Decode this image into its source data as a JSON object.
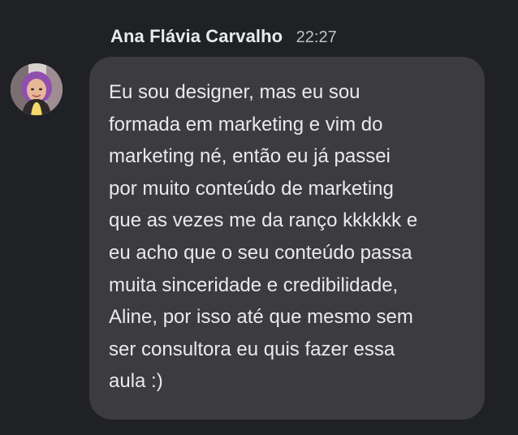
{
  "message": {
    "sender": "Ana Flávia Carvalho",
    "time": "22:27",
    "lines": [
      "Eu sou designer, mas eu sou",
      "formada em marketing e vim do",
      "marketing né, então eu já passei",
      "por muito conteúdo de marketing",
      "que as vezes me da ranço kkkkkk e",
      "eu acho que o seu conteúdo passa",
      "muita sinceridade e credibilidade,",
      "Aline, por isso até que mesmo sem",
      "ser consultora eu quis fazer essa",
      "aula :)"
    ]
  },
  "colors": {
    "background": "#202124",
    "bubble": "#3c3c3e",
    "text": "#e8eaed",
    "timestamp": "#bdc1c6"
  },
  "icons": {
    "avatar": "user-avatar-photo"
  }
}
